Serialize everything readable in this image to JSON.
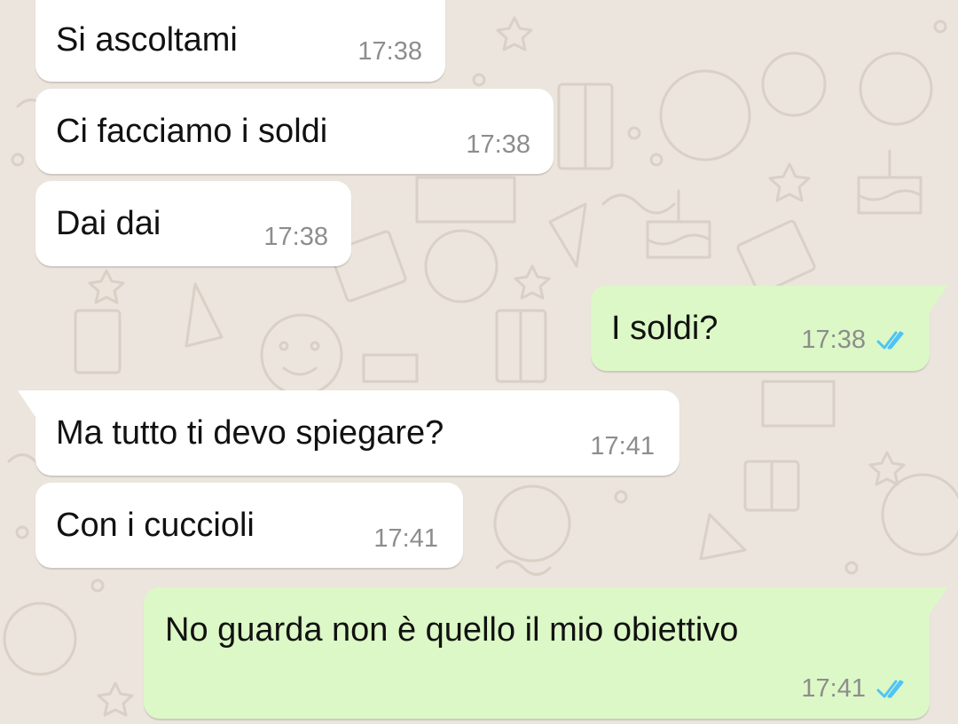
{
  "colors": {
    "wallpaper": "#ece5dd",
    "incoming_bubble": "#ffffff",
    "outgoing_bubble": "#dcf8c6",
    "timestamp": "#8d8d8d",
    "read_ticks": "#4fc3f7"
  },
  "messages": [
    {
      "direction": "incoming",
      "text": "Si ascoltami",
      "time": "17:38"
    },
    {
      "direction": "incoming",
      "text": "Ci facciamo i soldi",
      "time": "17:38"
    },
    {
      "direction": "incoming",
      "text": "Dai dai",
      "time": "17:38"
    },
    {
      "direction": "outgoing",
      "text": "I soldi?",
      "time": "17:38",
      "status_icon": "double-check-read-icon"
    },
    {
      "direction": "incoming",
      "text": "Ma tutto ti devo spiegare?",
      "time": "17:41"
    },
    {
      "direction": "incoming",
      "text": "Con i cuccioli",
      "time": "17:41"
    },
    {
      "direction": "outgoing",
      "text": "No guarda non è quello il mio obiettivo",
      "time": "17:41",
      "status_icon": "double-check-read-icon"
    }
  ]
}
